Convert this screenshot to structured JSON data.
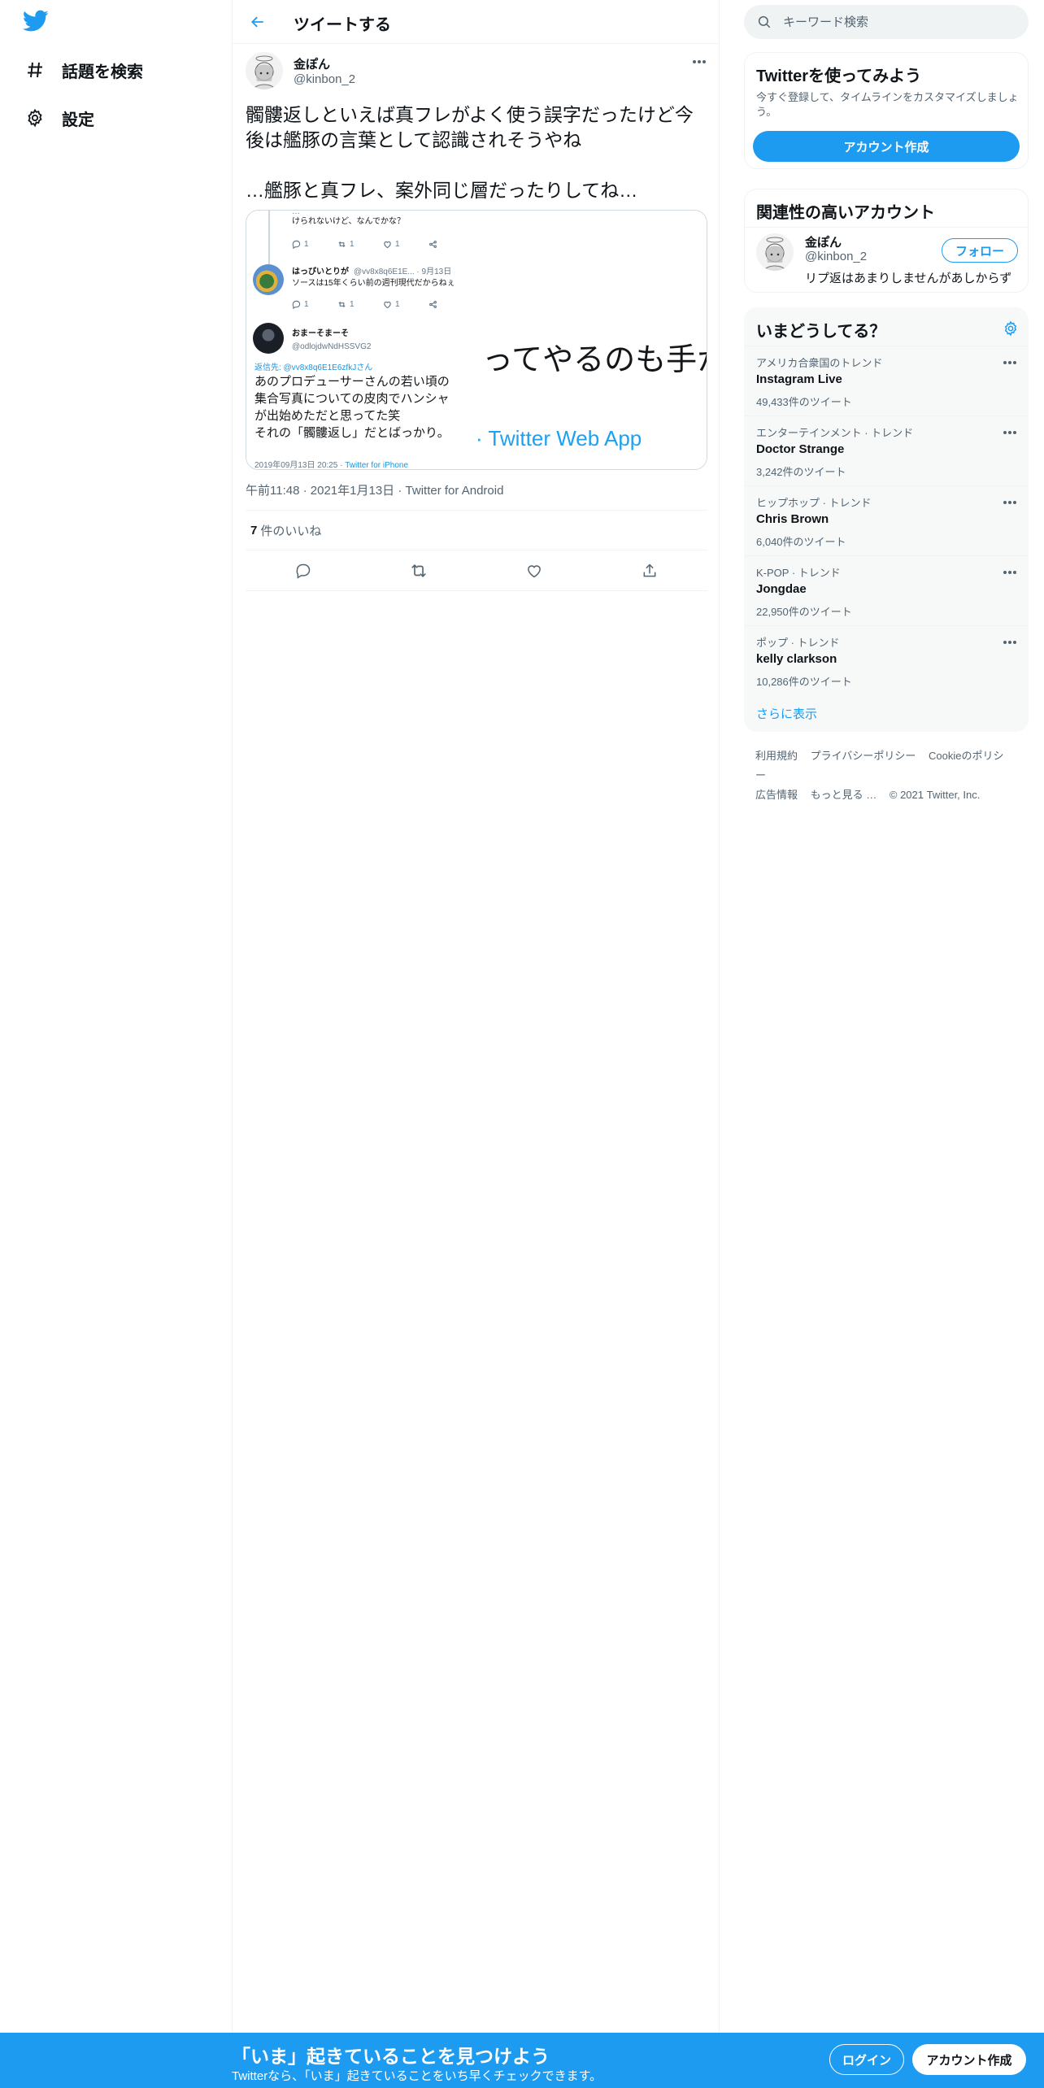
{
  "nav": {
    "logo_icon": "twitter-bird-icon",
    "items": [
      {
        "icon": "hashtag-icon",
        "label": "話題を検索"
      },
      {
        "icon": "gear-icon",
        "label": "設定"
      }
    ]
  },
  "header": {
    "title": "ツイートする"
  },
  "tweet": {
    "author_name": "金ぽん",
    "author_handle": "@kinbon_2",
    "text": "髑髏返しといえば真フレがよく使う誤字だったけど今後は艦豚の言葉として認識されそうやね\n\n…艦豚と真フレ、案外同じ層だったりしてね…",
    "media": {
      "left": {
        "top_text_1": "けられないけど、なんでかな？",
        "action_counts": [
          "1",
          "1",
          "1"
        ],
        "reply1_name": "はっぴいとりが",
        "reply1_handle": "@vv8x8q6E1E... · 9月13日",
        "reply1_text": "ソースは15年くらい前の週刊現代だからねぇ",
        "reply2_name": "おまーそまーそ",
        "reply2_handle": "@odlojdwNdHSSVG2",
        "reply_to": "返信先: @vv8x8q6E1E6zfkJさん",
        "body": "あのプロデューサーさんの若い頃の\n集合写真についての皮肉でハンシャ\nが出始めただと思ってた笑\nそれの「髑髏返し」だとばっかり。",
        "timestamp": "2019年09月13日 20:25 · ",
        "source": "Twitter for iPhone"
      },
      "right": {
        "big_text": "ってやるのも手か",
        "app_text": "· Twitter Web App"
      }
    },
    "time": "午前11:48",
    "date": "2021年1月13日",
    "client": "Twitter for Android",
    "like_count": "7",
    "like_label": "件のいいね",
    "meta_sep": "·"
  },
  "search": {
    "placeholder": "キーワード検索"
  },
  "signup_panel": {
    "title": "Twitterを使ってみよう",
    "desc": "今すぐ登録して、タイムラインをカスタマイズしましょう。",
    "button": "アカウント作成"
  },
  "related": {
    "title": "関連性の高いアカウント",
    "name": "金ぽん",
    "handle": "@kinbon_2",
    "bio": "リプ返はあまりしませんがあしからず",
    "follow": "フォロー"
  },
  "trends": {
    "title": "いまどうしてる？",
    "items": [
      {
        "context": "アメリカ合衆国のトレンド",
        "name": "Instagram Live",
        "count": "49,433件のツイート"
      },
      {
        "context": "エンターテインメント · トレンド",
        "name": "Doctor Strange",
        "count": "3,242件のツイート"
      },
      {
        "context": "ヒップホップ · トレンド",
        "name": "Chris Brown",
        "count": "6,040件のツイート"
      },
      {
        "context": "K-POP · トレンド",
        "name": "Jongdae",
        "count": "22,950件のツイート"
      },
      {
        "context": "ポップ · トレンド",
        "name": "kelly clarkson",
        "count": "10,286件のツイート"
      }
    ],
    "show_more": "さらに表示"
  },
  "footer": {
    "links": [
      "利用規約",
      "プライバシーポリシー",
      "Cookieのポリシー",
      "広告情報",
      "もっと見る …",
      "© 2021 Twitter, Inc."
    ]
  },
  "bottom_bar": {
    "title": "「いま」起きていることを見つけよう",
    "subtitle": "Twitterなら、「いま」起きていることをいち早くチェックできます。",
    "login": "ログイン",
    "signup": "アカウント作成"
  },
  "colors": {
    "accent": "#1d9bf0",
    "text": "#0f1419",
    "secondary": "#536471",
    "border": "#eff3f4"
  }
}
